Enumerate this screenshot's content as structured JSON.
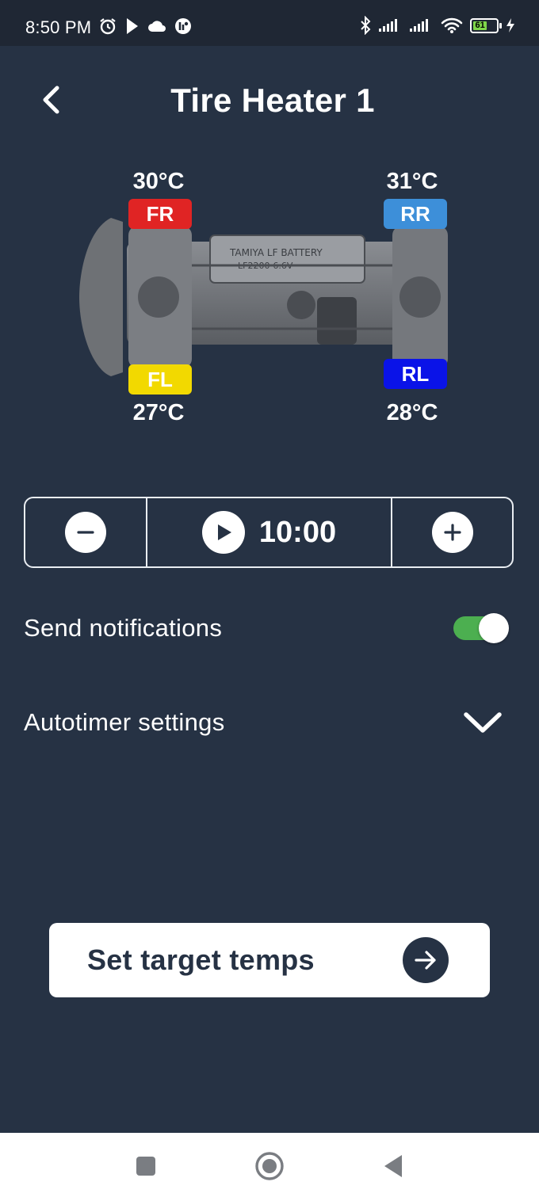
{
  "status_bar": {
    "time": "8:50 PM",
    "battery_level": "61",
    "icons_left": [
      "alarm-icon",
      "play-store-icon",
      "cloud-icon",
      "app-icon"
    ],
    "icons_right": [
      "bluetooth-icon",
      "signal-icon",
      "signal-icon",
      "wifi-icon",
      "battery-icon",
      "charging-icon"
    ]
  },
  "header": {
    "title": "Tire Heater 1",
    "back_icon": "chevron-left-icon"
  },
  "tires": {
    "fr": {
      "label": "FR",
      "temp": "30°C",
      "color": "#e02424"
    },
    "rr": {
      "label": "RR",
      "temp": "31°C",
      "color": "#3d8fd9"
    },
    "fl": {
      "label": "FL",
      "temp": "27°C",
      "color": "#f2d900"
    },
    "rl": {
      "label": "RL",
      "temp": "28°C",
      "color": "#0a13e8"
    }
  },
  "timer": {
    "value": "10:00",
    "decrease_icon": "minus-icon",
    "start_icon": "play-icon",
    "increase_icon": "plus-icon"
  },
  "settings": {
    "notifications_label": "Send notifications",
    "notifications_enabled": true,
    "autotimer_label": "Autotimer settings"
  },
  "cta": {
    "label": "Set target temps",
    "icon": "arrow-right-icon"
  },
  "nav": [
    "recents-icon",
    "home-icon",
    "back-icon"
  ],
  "colors": {
    "background": "#263244",
    "toggle_on": "#4caf50",
    "surface": "#ffffff"
  }
}
